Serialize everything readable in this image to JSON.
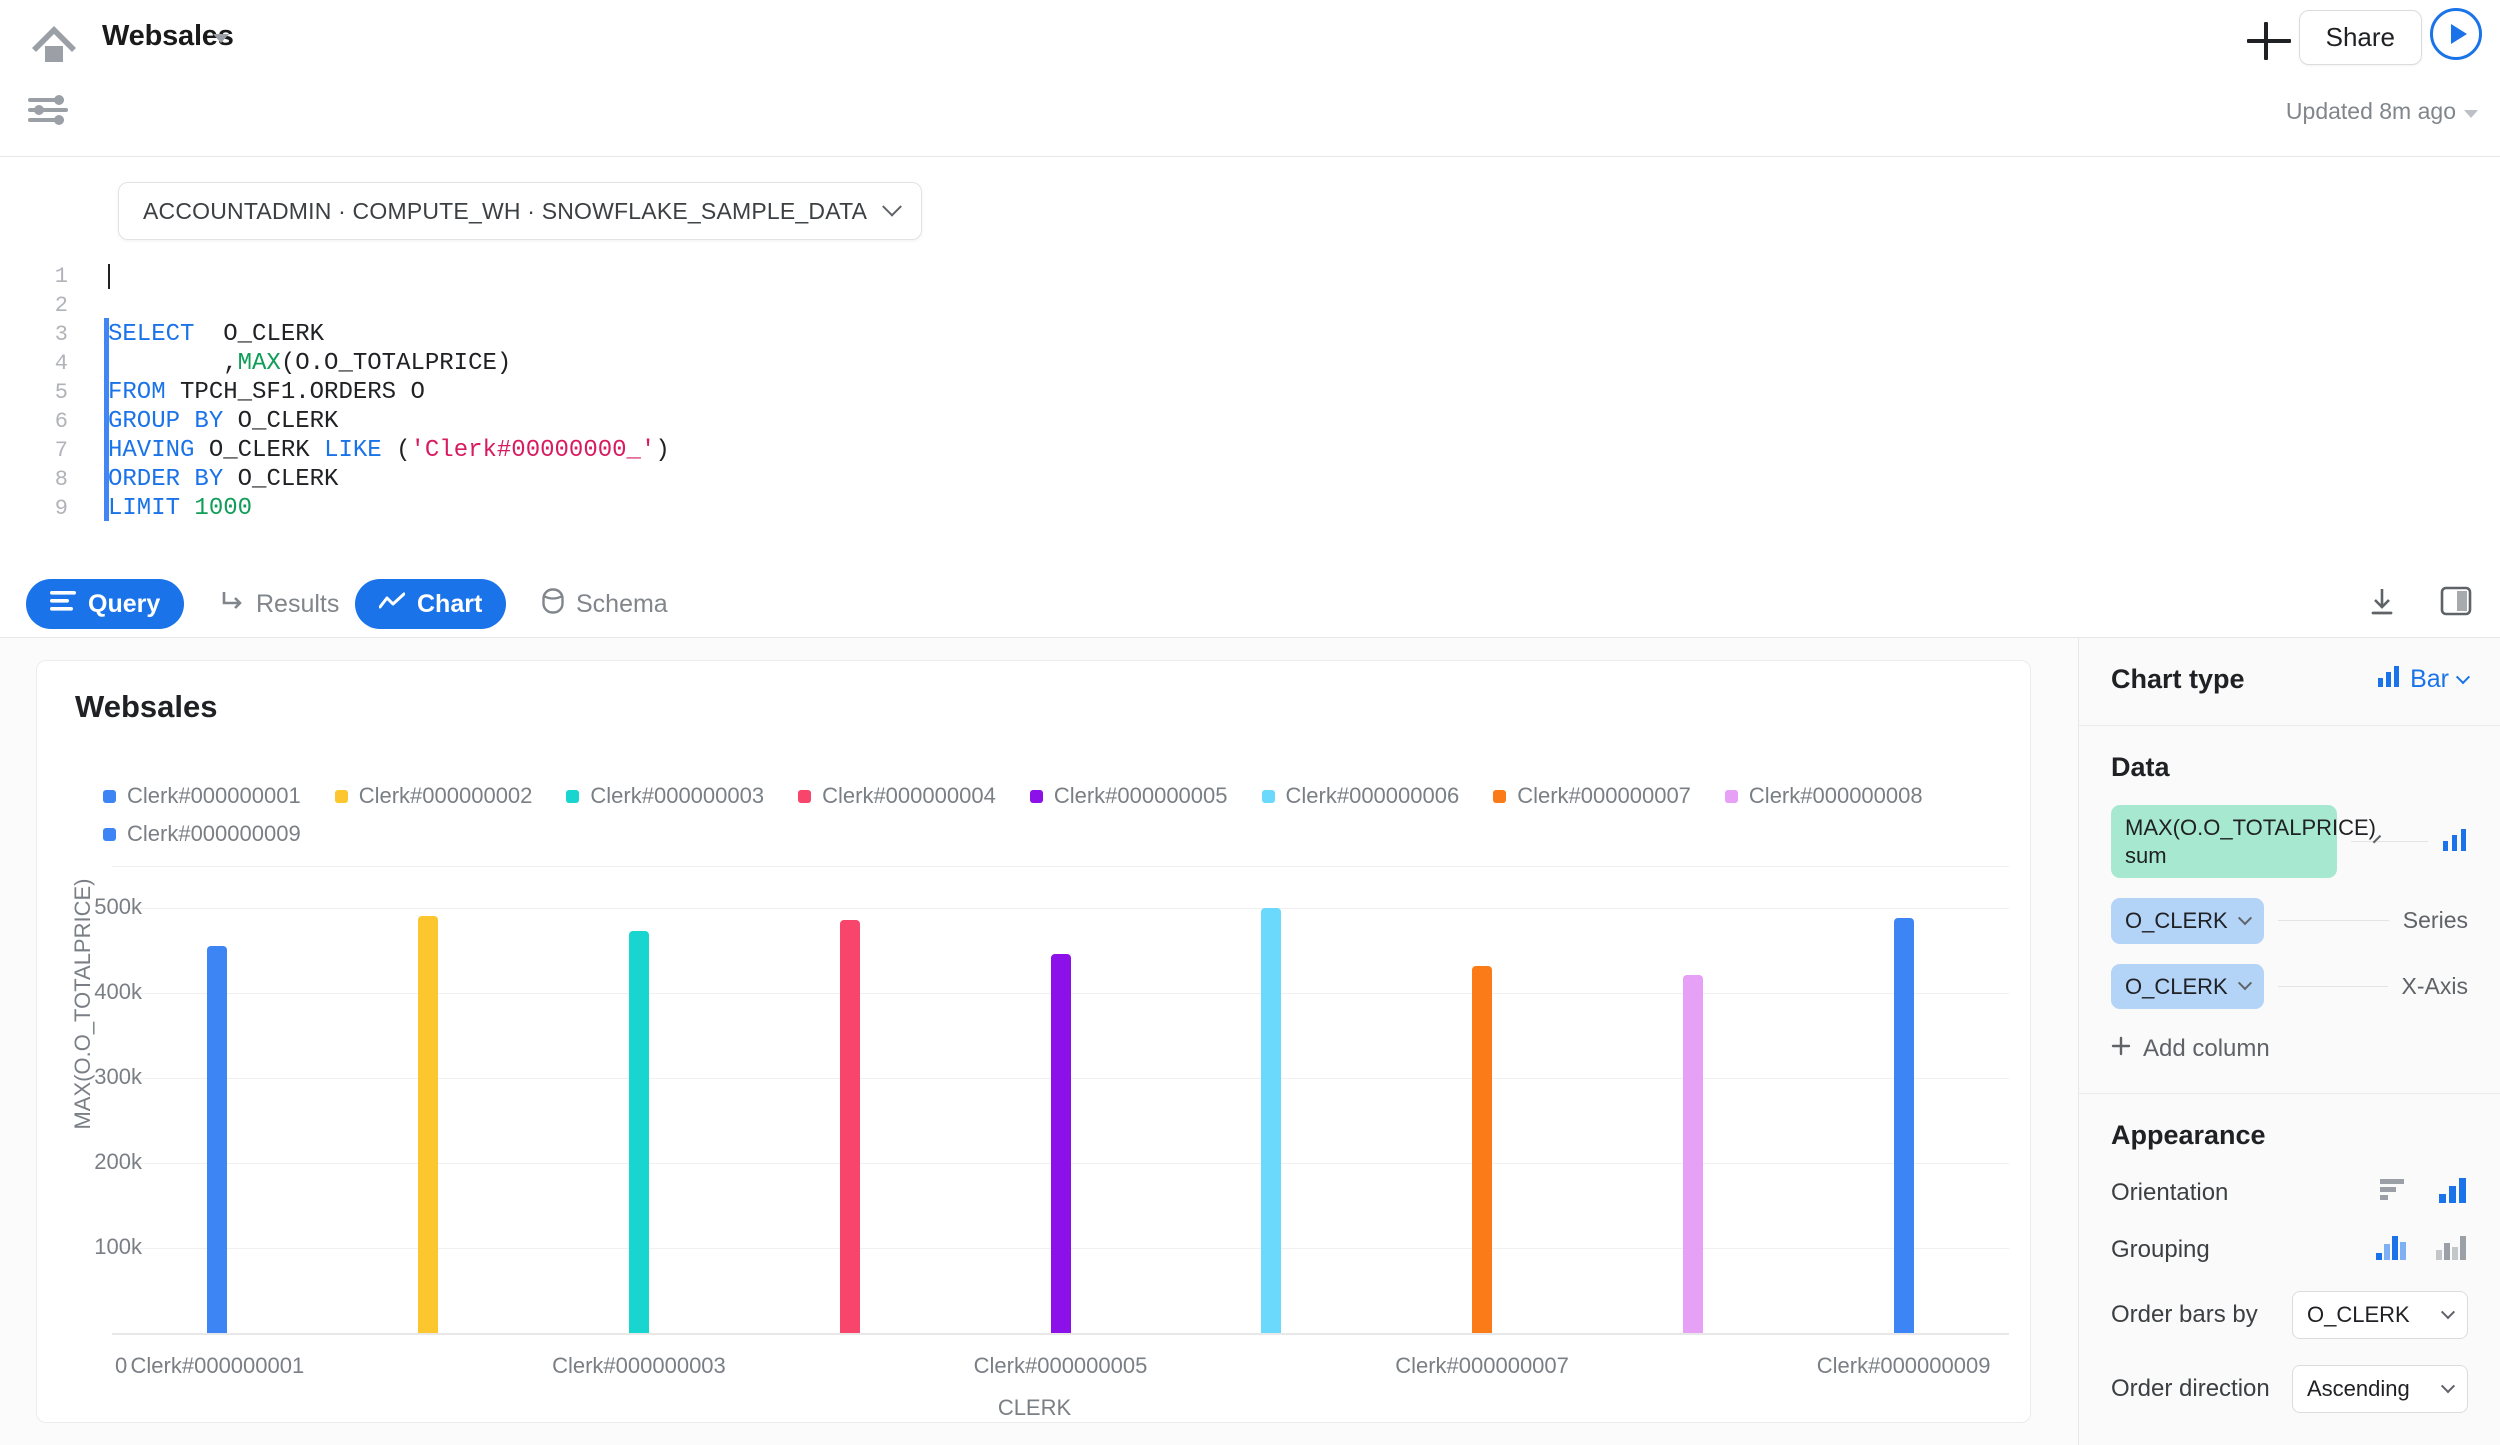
{
  "topbar": {
    "app_title": "Websales",
    "home_icon": "home-icon",
    "filters_icon": "sliders-icon",
    "plus_label": "+",
    "share_label": "Share",
    "run_label": "run-icon",
    "updated_text": "Updated 8m ago"
  },
  "context": {
    "chip_text": "ACCOUNTADMIN · COMPUTE_WH · SNOWFLAKE_SAMPLE_DATA"
  },
  "editor": {
    "line_numbers": [
      "1",
      "2",
      "3",
      "4",
      "5",
      "6",
      "7",
      "8",
      "9"
    ],
    "lines": [
      "",
      "",
      "SELECT  O_CLERK",
      "        ,MAX(O.O_TOTALPRICE)",
      "FROM TPCH_SF1.ORDERS O",
      "GROUP BY O_CLERK",
      "HAVING O_CLERK LIKE ('Clerk#00000000_')",
      "ORDER BY O_CLERK",
      "LIMIT 1000"
    ]
  },
  "tabs": [
    {
      "label": "Query",
      "icon": "lines-icon",
      "active": true
    },
    {
      "label": "Results",
      "icon": "arrow-turn-icon",
      "active": false
    },
    {
      "label": "Chart",
      "icon": "line-chart-icon",
      "active": true
    },
    {
      "label": "Schema",
      "icon": "database-icon",
      "active": false
    }
  ],
  "toolbar": {
    "download_icon": "download-icon",
    "split_panel_icon": "split-panel-icon"
  },
  "chart_data": {
    "type": "bar",
    "title": "Websales",
    "xlabel": "CLERK",
    "ylabel": "MAX(O.O_TOTALPRICE)",
    "ylim": [
      0,
      550000
    ],
    "yticks": [
      100000,
      200000,
      300000,
      400000,
      500000
    ],
    "ytick_labels": [
      "100k",
      "200k",
      "300k",
      "400k",
      "500k"
    ],
    "zero_label": "0",
    "grid": true,
    "legend_position": "top",
    "categories": [
      "Clerk#000000001",
      "Clerk#000000002",
      "Clerk#000000003",
      "Clerk#000000004",
      "Clerk#000000005",
      "Clerk#000000006",
      "Clerk#000000007",
      "Clerk#000000008",
      "Clerk#000000009"
    ],
    "xtick_labels": [
      "Clerk#000000001",
      "Clerk#000000003",
      "Clerk#000000005",
      "Clerk#000000007",
      "Clerk#000000009"
    ],
    "values": [
      456000,
      491000,
      474000,
      486000,
      446000,
      500000,
      432000,
      422000,
      489000
    ],
    "colors": [
      "#3d85f5",
      "#fcc62e",
      "#18d5cf",
      "#f8456b",
      "#8c10e8",
      "#6ad9fb",
      "#fa7b18",
      "#e6a0f5",
      "#3d85f5"
    ],
    "legend": [
      {
        "label": "Clerk#000000001",
        "color": "#3d85f5"
      },
      {
        "label": "Clerk#000000002",
        "color": "#fcc62e"
      },
      {
        "label": "Clerk#000000003",
        "color": "#18d5cf"
      },
      {
        "label": "Clerk#000000004",
        "color": "#f8456b"
      },
      {
        "label": "Clerk#000000005",
        "color": "#8c10e8"
      },
      {
        "label": "Clerk#000000006",
        "color": "#6ad9fb"
      },
      {
        "label": "Clerk#000000007",
        "color": "#fa7b18"
      },
      {
        "label": "Clerk#000000008",
        "color": "#e6a0f5"
      },
      {
        "label": "Clerk#000000009",
        "color": "#3d85f5"
      }
    ]
  },
  "panel": {
    "chart_type": {
      "title": "Chart type",
      "value": "Bar",
      "icon": "bar-chart-icon"
    },
    "data": {
      "title": "Data",
      "measure_pill": "MAX(O.O_TOTALPRICE)\nsum",
      "measure_icon": "bar-chart-icon",
      "series_pill": "O_CLERK",
      "series_label": "Series",
      "xaxis_pill": "O_CLERK",
      "xaxis_label": "X-Axis",
      "add_column": "Add column"
    },
    "appearance": {
      "title": "Appearance",
      "orientation_label": "Orientation",
      "orientation_horizontal_icon": "horizontal-bars-icon",
      "orientation_vertical_icon": "vertical-bars-icon",
      "grouping_label": "Grouping",
      "grouping_stacked_icon": "stacked-bars-icon",
      "grouping_grouped_icon": "grouped-bars-icon",
      "order_bars_by_label": "Order bars by",
      "order_bars_by_value": "O_CLERK",
      "order_direction_label": "Order direction",
      "order_direction_value": "Ascending"
    }
  }
}
